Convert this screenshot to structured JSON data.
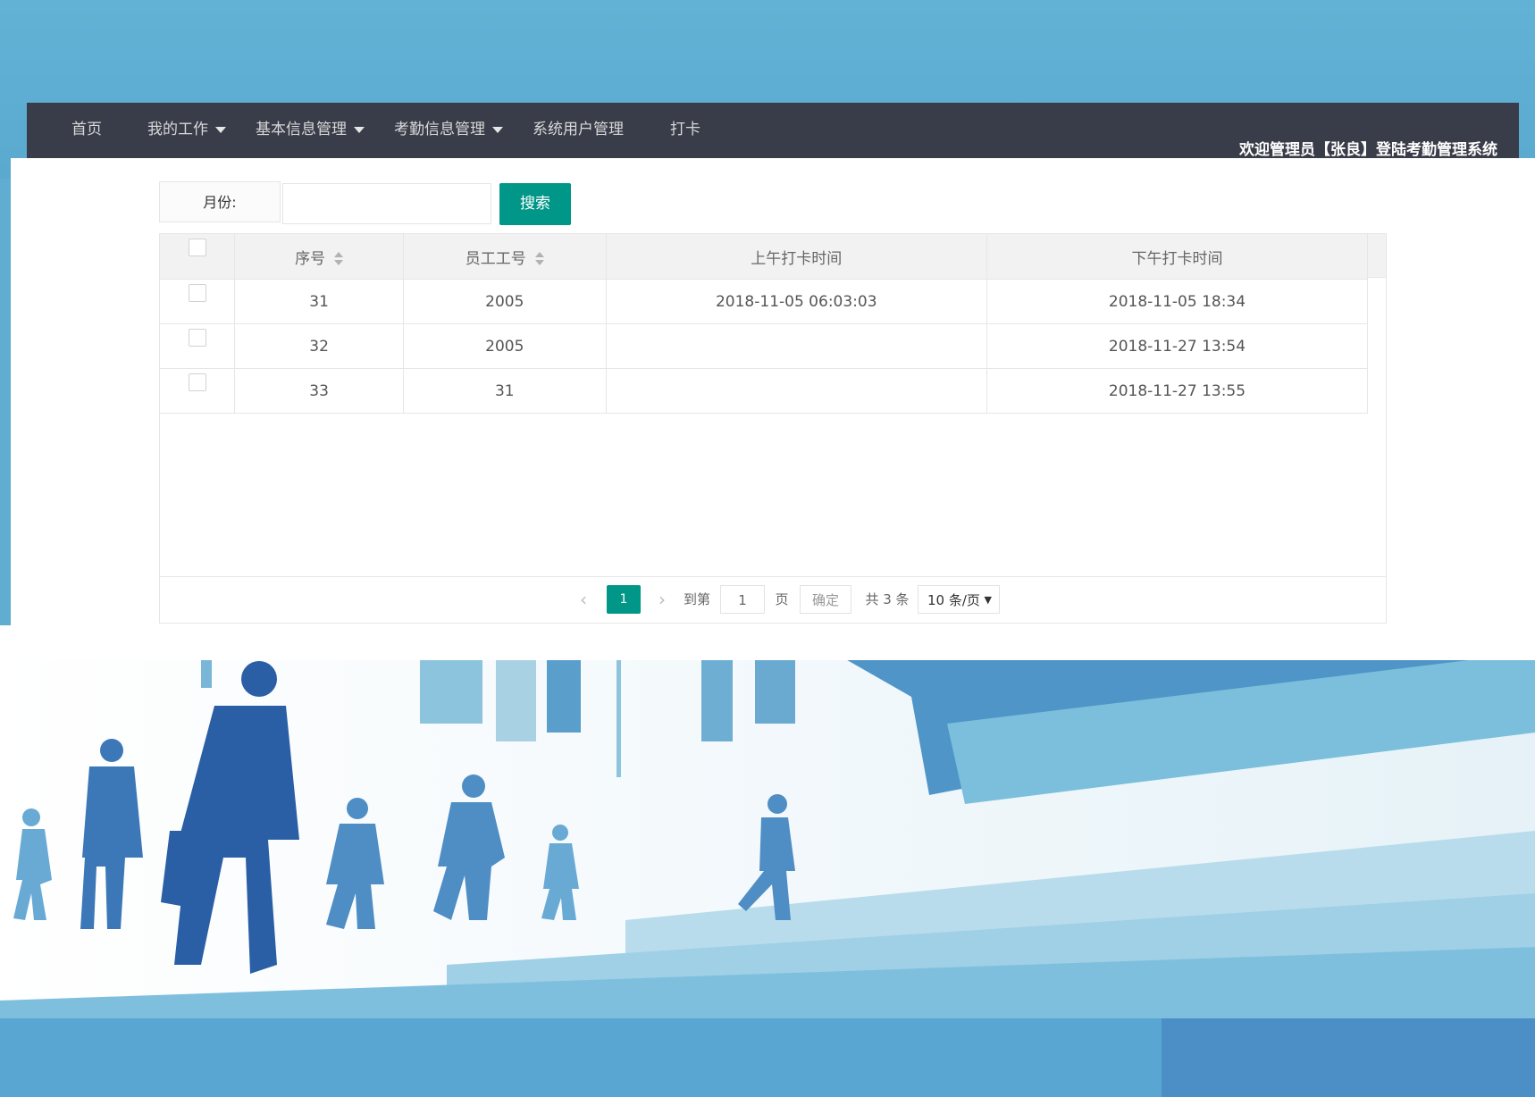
{
  "navbar": {
    "items": [
      {
        "label": "首页",
        "has_dropdown": false
      },
      {
        "label": "我的工作",
        "has_dropdown": true
      },
      {
        "label": "基本信息管理",
        "has_dropdown": true
      },
      {
        "label": "考勤信息管理",
        "has_dropdown": true
      },
      {
        "label": "系统用户管理",
        "has_dropdown": false
      },
      {
        "label": "打卡",
        "has_dropdown": false
      }
    ],
    "welcome": "欢迎管理员【张良】登陆考勤管理系统"
  },
  "search": {
    "label": "月份:",
    "value": "",
    "button": "搜索"
  },
  "table": {
    "columns": [
      "序号",
      "员工工号",
      "上午打卡时间",
      "下午打卡时间"
    ],
    "rows": [
      {
        "id": "31",
        "emp_no": "2005",
        "am_time": "2018-11-05 06:03:03",
        "pm_time": "2018-11-05 18:34"
      },
      {
        "id": "32",
        "emp_no": "2005",
        "am_time": "",
        "pm_time": "2018-11-27 13:54"
      },
      {
        "id": "33",
        "emp_no": "31",
        "am_time": "",
        "pm_time": "2018-11-27 13:55"
      }
    ]
  },
  "pagination": {
    "prev": "‹",
    "current": "1",
    "next": "›",
    "goto_label": "到第",
    "goto_value": "1",
    "page_label": "页",
    "confirm": "确定",
    "total": "共 3 条",
    "page_size": "10 条/页"
  },
  "colors": {
    "navbar_bg": "#393d49",
    "accent": "#009688",
    "background": "#5fadd0"
  }
}
